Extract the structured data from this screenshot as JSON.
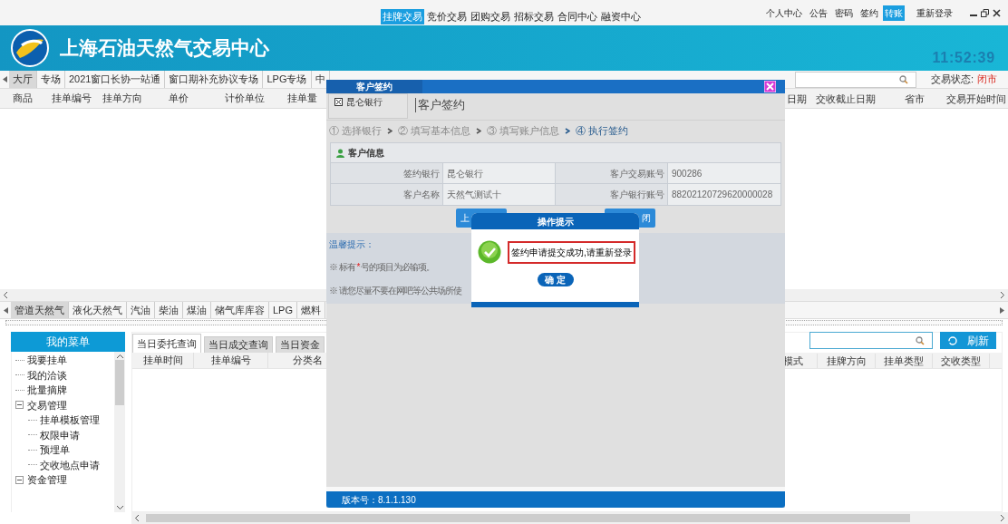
{
  "top_nav": {
    "links": [
      {
        "label": "挂牌交易",
        "selected": true
      },
      {
        "label": "竞价交易",
        "selected": false
      },
      {
        "label": "团购交易",
        "selected": false
      },
      {
        "label": "招标交易",
        "selected": false
      },
      {
        "label": "合同中心",
        "selected": false
      },
      {
        "label": "融资中心",
        "selected": false
      }
    ],
    "user_links": [
      {
        "label": "个人中心",
        "selected": false
      },
      {
        "label": "公告",
        "selected": false
      },
      {
        "label": "密码",
        "selected": false
      },
      {
        "label": "签约",
        "selected": false
      },
      {
        "label": "转账",
        "selected": true
      },
      {
        "label": "重新登录",
        "selected": false
      }
    ]
  },
  "header": {
    "title": "上海石油天然气交易中心",
    "clock": "11:52:39"
  },
  "market_tabs": [
    {
      "label": "大厅",
      "selected": true
    },
    {
      "label": "专场",
      "selected": false
    },
    {
      "label": "2021窗口长协一站通",
      "selected": false
    },
    {
      "label": "窗口期补充协议专场",
      "selected": false
    },
    {
      "label": "LPG专场",
      "selected": false
    },
    {
      "label": "中",
      "selected": false
    }
  ],
  "trade_status": {
    "label": "交易状态:",
    "value": "闭市"
  },
  "listing_table": {
    "columns": [
      "商品",
      "挂单编号",
      "挂单方向",
      "单价",
      "计价单位",
      "挂单量"
    ],
    "right_columns": [
      "日期",
      "交收截止日期",
      "省市",
      "交易开始时间"
    ]
  },
  "category_tabs": [
    {
      "label": "管道天然气",
      "selected": true
    },
    {
      "label": "液化天然气",
      "selected": false
    },
    {
      "label": "汽油",
      "selected": false
    },
    {
      "label": "柴油",
      "selected": false
    },
    {
      "label": "煤油",
      "selected": false
    },
    {
      "label": "储气库库容",
      "selected": false
    },
    {
      "label": "LPG",
      "selected": false
    },
    {
      "label": "燃料",
      "selected": false
    }
  ],
  "menu": {
    "title": "我的菜单",
    "items": [
      {
        "label": "我要挂单"
      },
      {
        "label": "我的洽谈"
      },
      {
        "label": "批量摘牌"
      },
      {
        "label": "交易管理",
        "expanded": true,
        "children": [
          {
            "label": "挂单模板管理"
          },
          {
            "label": "权限申请"
          },
          {
            "label": "预埋单"
          },
          {
            "label": "交收地点申请"
          }
        ]
      },
      {
        "label": "资金管理",
        "expanded": true
      }
    ]
  },
  "query_tabs": [
    {
      "label": "当日委托查询",
      "selected": true
    },
    {
      "label": "当日成交查询",
      "selected": false
    },
    {
      "label": "当日资金",
      "selected": false
    }
  ],
  "query_table": {
    "columns": [
      "挂单时间",
      "挂单编号",
      "分类名"
    ],
    "right_columns": [
      "模式",
      "挂牌方向",
      "挂单类型",
      "交收类型"
    ]
  },
  "refresh_button": "刷新",
  "dialog": {
    "title": "客户签约",
    "bank_tab": "昆仑银行",
    "heading": "客户签约",
    "steps": [
      {
        "label": "① 选择银行",
        "active": false
      },
      {
        "label": "② 填写基本信息",
        "active": false
      },
      {
        "label": "③ 填写账户信息",
        "active": false
      },
      {
        "label": "④ 执行签约",
        "active": true
      }
    ],
    "section": "客户信息",
    "fields": [
      {
        "label": "签约银行",
        "value": "昆仑银行"
      },
      {
        "label": "客户交易账号",
        "value": "900286"
      },
      {
        "label": "客户名称",
        "value": "天然气测试十"
      },
      {
        "label": "客户银行账号",
        "value": "88202120729620000028"
      }
    ],
    "buttons": [
      "上",
      "闭"
    ],
    "tips_title": "温馨提示：",
    "tips": [
      {
        "before": "※ 标有 ",
        "mark": "*",
        "after": " 号的项目为必输项。"
      },
      {
        "before": "※ 请您尽量不要在网吧等公共场所使"
      }
    ],
    "version": "版本号：8.1.1.130"
  },
  "alert": {
    "title": "操作提示",
    "message": "签约申请提交成功,请重新登录",
    "button": "确 定"
  }
}
